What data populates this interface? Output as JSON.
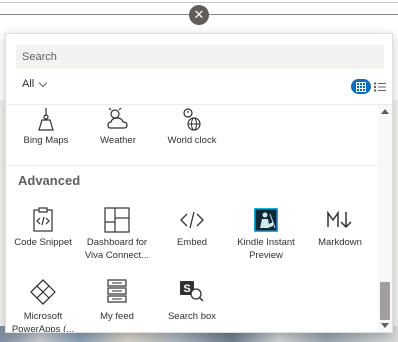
{
  "close": {
    "symbol": "✕"
  },
  "search": {
    "placeholder": "Search"
  },
  "filter": {
    "label": "All"
  },
  "colors": {
    "accent": "#0f6cbd",
    "section_title": "#605e5c"
  },
  "view": {
    "grid_icon": "grid-view-icon",
    "list_icon": "list-view-icon"
  },
  "rows_top": [
    {
      "label": "Bing Maps",
      "icon": "map-pin-icon"
    },
    {
      "label": "Weather",
      "icon": "weather-icon"
    },
    {
      "label": "World clock",
      "icon": "world-clock-icon"
    }
  ],
  "section": {
    "title": "Advanced"
  },
  "advanced_row1": [
    {
      "label_line1": "Code Snippet",
      "label_line2": "",
      "icon": "code-snippet-icon"
    },
    {
      "label_line1": "Dashboard for",
      "label_line2": "Viva Connect...",
      "icon": "dashboard-icon"
    },
    {
      "label_line1": "Embed",
      "label_line2": "",
      "icon": "embed-icon"
    },
    {
      "label_line1": "Kindle Instant",
      "label_line2": "Preview",
      "icon": "kindle-icon"
    },
    {
      "label_line1": "Markdown",
      "label_line2": "",
      "icon": "markdown-icon"
    }
  ],
  "advanced_row2": [
    {
      "label_line1": "Microsoft",
      "label_line2": "PowerApps (...",
      "icon": "powerapps-icon"
    },
    {
      "label_line1": "My feed",
      "label_line2": "",
      "icon": "my-feed-icon"
    },
    {
      "label_line1": "Search box",
      "label_line2": "",
      "icon": "search-box-icon"
    }
  ]
}
